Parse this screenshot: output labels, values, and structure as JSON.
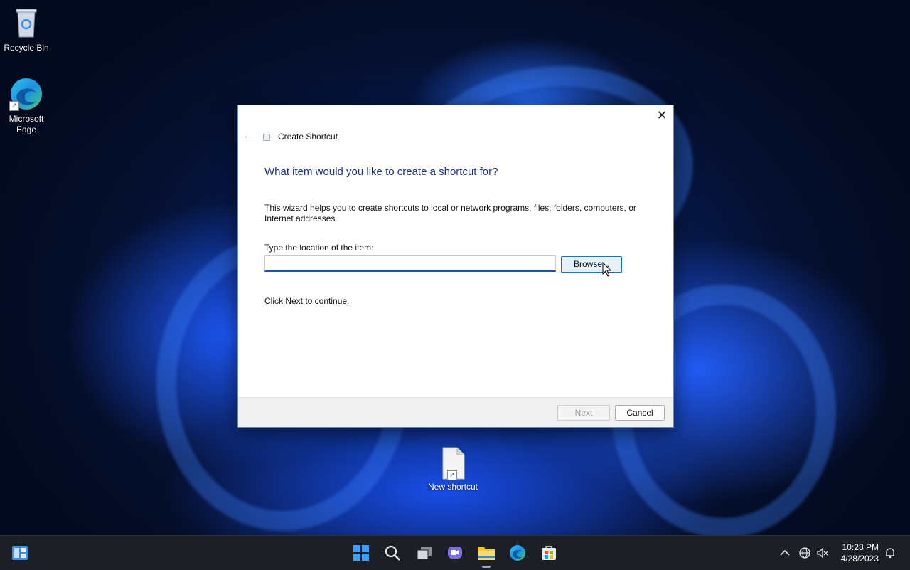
{
  "desktop": {
    "icons": [
      {
        "label": "Recycle Bin",
        "icon": "recycle-bin-icon"
      },
      {
        "label": "Microsoft Edge",
        "icon": "edge-icon"
      },
      {
        "label": "New shortcut",
        "icon": "file-shortcut-icon"
      }
    ]
  },
  "dialog": {
    "title": "Create Shortcut",
    "heading": "What item would you like to create a shortcut for?",
    "intro": "This wizard helps you to create shortcuts to local or network programs, files, folders, computers, or Internet addresses.",
    "location_label": "Type the location of the item:",
    "location_value": "",
    "browse_label": "Browse...",
    "continue_text": "Click Next to continue.",
    "next_label": "Next",
    "cancel_label": "Cancel",
    "close_glyph": "✕",
    "back_glyph": "←"
  },
  "taskbar": {
    "apps": [
      "widgets-icon",
      "start-icon",
      "search-icon",
      "task-view-icon",
      "teams-chat-icon",
      "file-explorer-icon",
      "edge-icon",
      "store-icon"
    ],
    "time": "10:28 PM",
    "date": "4/28/2023"
  },
  "colors": {
    "heading": "#1e3287",
    "accent": "#0078d7",
    "taskbar": "#1c1f26"
  }
}
